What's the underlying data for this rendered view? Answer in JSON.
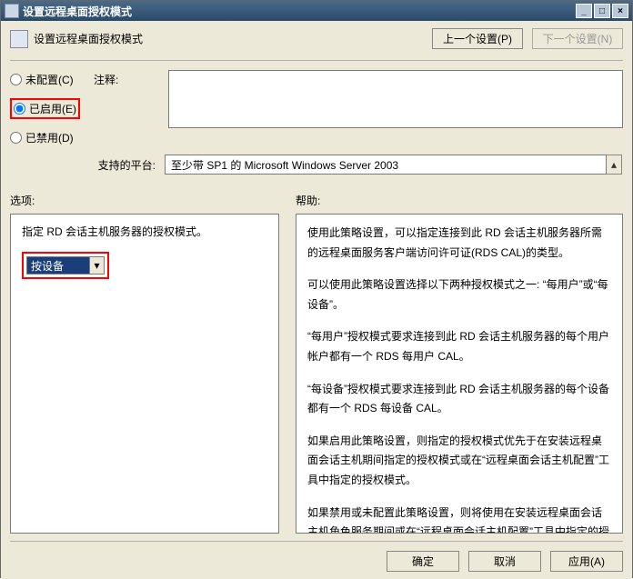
{
  "window": {
    "title": "设置远程桌面授权模式"
  },
  "header": {
    "page_title": "设置远程桌面授权模式",
    "prev_btn": "上一个设置(P)",
    "next_btn": "下一个设置(N)"
  },
  "radios": {
    "not_configured": "未配置(C)",
    "enabled": "已启用(E)",
    "disabled": "已禁用(D)",
    "selected": "enabled"
  },
  "labels": {
    "comment": "注释:",
    "platform": "支持的平台:",
    "options": "选项:",
    "help": "帮助:"
  },
  "platform_text": "至少带 SP1 的 Microsoft Windows Server 2003",
  "options_panel": {
    "desc": "指定 RD 会话主机服务器的授权模式。",
    "select_value": "按设备"
  },
  "help_panel": {
    "p1": "使用此策略设置，可以指定连接到此 RD 会话主机服务器所需的远程桌面服务客户端访问许可证(RDS CAL)的类型。",
    "p2": "可以使用此策略设置选择以下两种授权模式之一: “每用户”或“每设备”。",
    "p3": "“每用户”授权模式要求连接到此 RD 会话主机服务器的每个用户帐户都有一个 RDS 每用户 CAL。",
    "p4": "“每设备”授权模式要求连接到此 RD 会话主机服务器的每个设备都有一个 RDS 每设备 CAL。",
    "p5": "如果启用此策略设置，则指定的授权模式优先于在安装远程桌面会话主机期间指定的授权模式或在“远程桌面会话主机配置”工具中指定的授权模式。",
    "p6": "如果禁用或未配置此策略设置，则将使用在安装远程桌面会话主机角色服务期间或在“远程桌面会话主机配置”工具中指定的授权模式。"
  },
  "buttons": {
    "ok": "确定",
    "cancel": "取消",
    "apply": "应用(A)"
  }
}
